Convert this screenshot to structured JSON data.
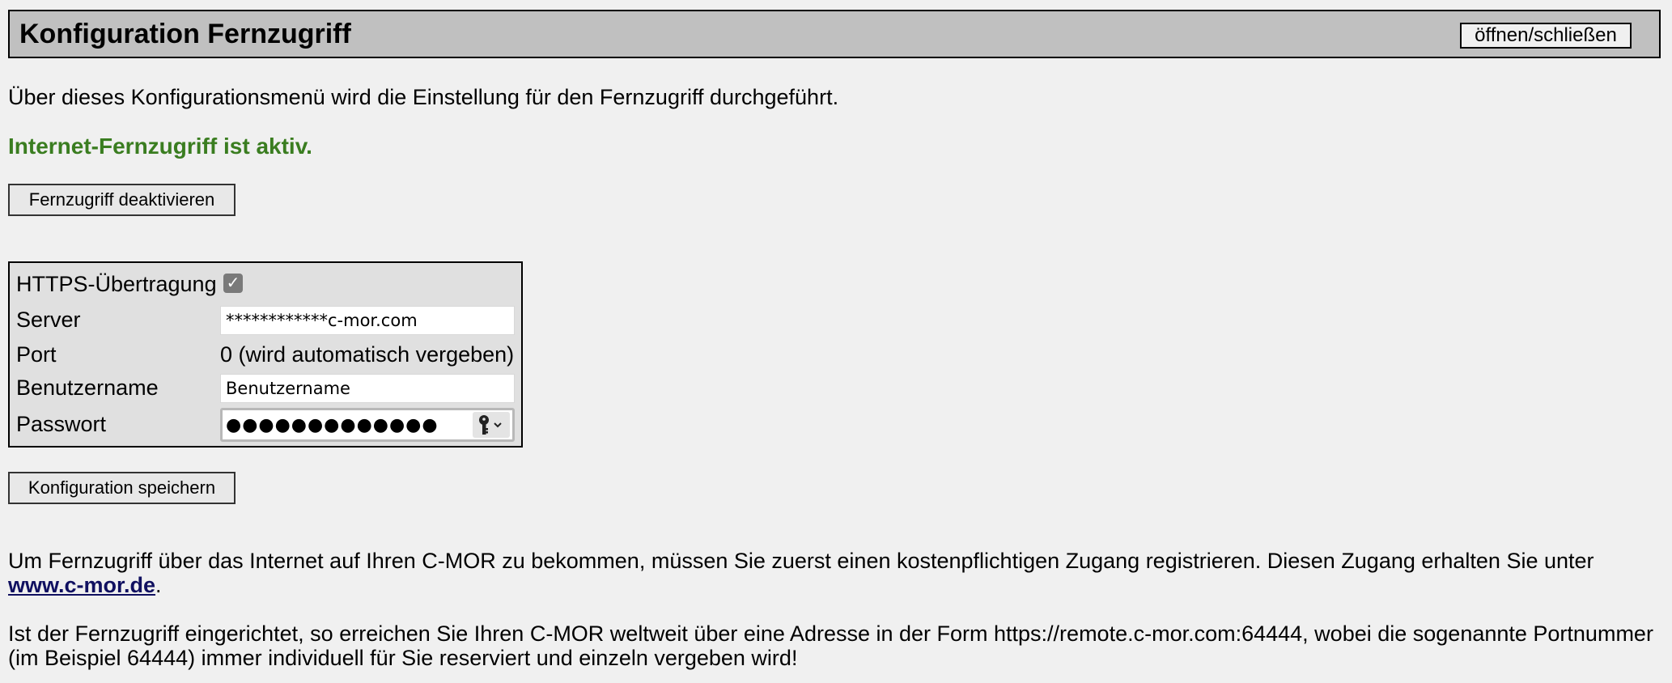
{
  "header": {
    "title": "Konfiguration Fernzugriff",
    "toggle_label": "öffnen/schließen"
  },
  "intro_text": "Über dieses Konfigurationsmenü wird die Einstellung für den Fernzugriff durchgeführt.",
  "status_text": "Internet-Fernzugriff ist aktiv.",
  "colors": {
    "status": "#3a7d20",
    "header_background": "#c0c0c0",
    "page_background": "#f0f0f0",
    "link": "#101060"
  },
  "buttons": {
    "deactivate_label": "Fernzugriff deaktivieren",
    "save_label": "Konfiguration speichern"
  },
  "form": {
    "https_label": "HTTPS-Übertragung",
    "https_checked": true,
    "server_label": "Server",
    "server_value": "************c-mor.com",
    "port_label": "Port",
    "port_value": "0 (wird automatisch vergeben)",
    "username_label": "Benutzername",
    "username_value": "Benutzername",
    "password_label": "Passwort",
    "password_value": "●●●●●●●●●●●●●",
    "password_icon": "key-icon"
  },
  "info": {
    "para1_text": "Um Fernzugriff über das Internet auf Ihren C-MOR zu bekommen, müssen Sie zuerst einen kostenpflichtigen Zugang registrieren. Diesen Zugang erhalten Sie unter ",
    "para1_link": "www.c-mor.de",
    "para1_end": ".",
    "para2_line1": "Ist der Fernzugriff eingerichtet, so erreichen Sie Ihren C-MOR weltweit über eine Adresse in der Form https://remote.c-mor.com:64444, wobei die sogenannte Portnummer",
    "para2_line2": "(im Beispiel 64444) immer individuell für Sie reserviert und einzeln vergeben wird!"
  }
}
